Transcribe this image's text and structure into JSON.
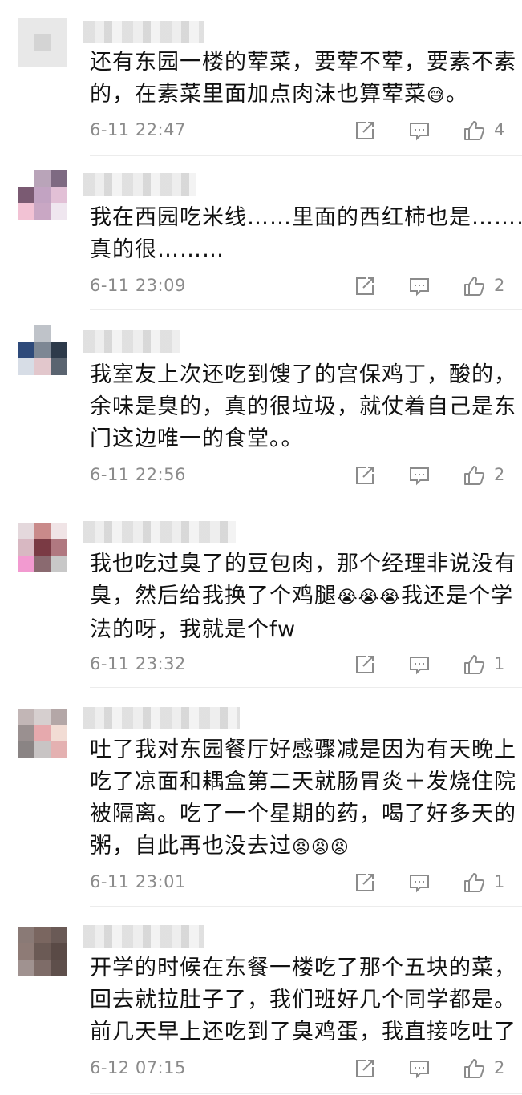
{
  "comments": [
    {
      "lines": [
        "还有东园一楼的荤菜，要荤不荤，要素不素",
        "的，在素菜里面加点肉沫也算荤菜"
      ],
      "emoji": "😅",
      "tail": "。",
      "time": "6-11 22:47",
      "likes": "4",
      "avatar": [
        "#e8e8e8",
        "#e8e8e8",
        "#e8e8e8",
        "#e8e8e8",
        "#d4d4d4",
        "#e8e8e8",
        "#e8e8e8",
        "#e8e8e8",
        "#e8e8e8"
      ]
    },
    {
      "lines": [
        "我在西园吃米线……里面的西红柿也是………",
        "真的很………"
      ],
      "emoji": "",
      "tail": "",
      "time": "6-11 23:09",
      "likes": "2",
      "avatar": [
        "#ffffff",
        "#b9a4b9",
        "#7e6a82",
        "#7a5a72",
        "#c2a3c2",
        "#e2c0d6",
        "#f2c2d4",
        "#c9a7c4",
        "#efe6ef"
      ]
    },
    {
      "lines": [
        "我室友上次还吃到馊了的宫保鸡丁，酸的，",
        "余味是臭的，真的很垃圾，就仗着自己是东",
        "门这边唯一的食堂。。"
      ],
      "emoji": "",
      "tail": "",
      "time": "6-11 22:56",
      "likes": "2",
      "avatar": [
        "#ffffff",
        "#bfc3c9",
        "#ffffff",
        "#2e4a7a",
        "#7d8794",
        "#2d3a4a",
        "#d7dde6",
        "#e2c7cc",
        "#5a6470"
      ]
    },
    {
      "lines": [
        "我也吃过臭了的豆包肉，那个经理非说没有",
        "臭，然后给我换了个鸡腿",
        "法的呀，我就是个fw"
      ],
      "emoji": "😭😭😭",
      "mid": "我还是个学",
      "tail": "",
      "time": "6-11 23:32",
      "likes": "1",
      "avatar": [
        "#e4d8dc",
        "#c98a8a",
        "#f0e4e6",
        "#d8b8c2",
        "#7a3a44",
        "#b07880",
        "#f29ad0",
        "#8a6a70",
        "#c8c8c8"
      ]
    },
    {
      "lines": [
        "吐了我对东园餐厅好感骤减是因为有天晚上",
        "吃了凉面和耦盒第二天就肠胃炎＋发烧住院",
        "被隔离。吃了一个星期的药，喝了好多天的",
        "粥，自此再也没去过"
      ],
      "emoji": "😡😡😡",
      "tail": "",
      "time": "6-11 23:01",
      "likes": "1",
      "avatar": [
        "#c2b6b6",
        "#d6cfcf",
        "#b4a7a7",
        "#9a9090",
        "#e6a9ad",
        "#f2dcd4",
        "#8a8484",
        "#c8c4c4",
        "#e4b1b1"
      ]
    },
    {
      "lines": [
        "开学的时候在东餐一楼吃了那个五块的菜，",
        "回去就拉肚子了，我们班好几个同学都是。",
        "前几天早上还吃到了臭鸡蛋，我直接吃吐了"
      ],
      "emoji": "",
      "tail": "",
      "time": "6-12 07:15",
      "likes": "2",
      "avatar": [
        "#8a7a76",
        "#7a6660",
        "#6a5a56",
        "#8e7b76",
        "#6b5a55",
        "#5a4a46",
        "#a09290",
        "#7e6c68",
        "#5e4f4b"
      ]
    }
  ],
  "icons": {
    "share": "share-edit-icon",
    "reply": "reply-comment-icon",
    "like": "thumbs-up-icon"
  }
}
